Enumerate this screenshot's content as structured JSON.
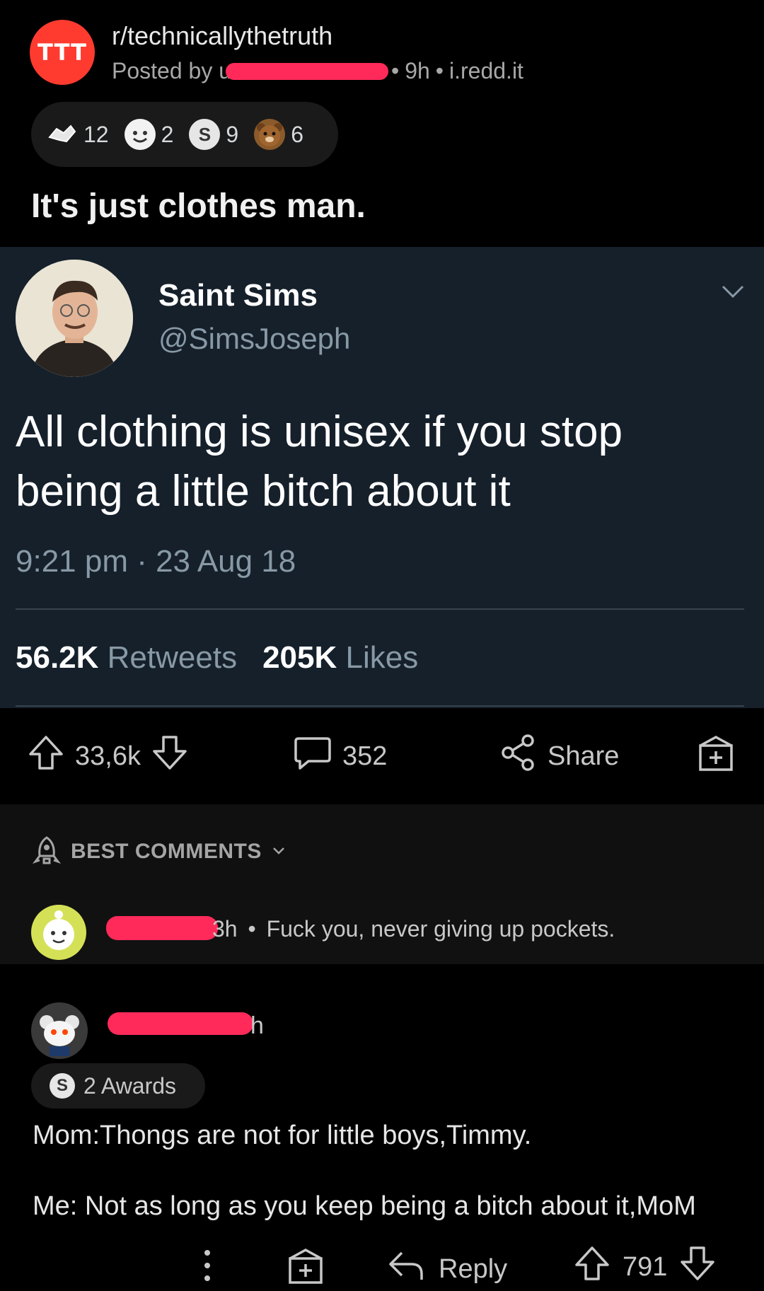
{
  "header": {
    "subreddit_icon_text": "TTT",
    "subreddit": "r/technicallythetruth",
    "posted_by_prefix": "Posted by u",
    "time": "9h",
    "domain": "i.redd.it",
    "separator": "•"
  },
  "awards": [
    {
      "icon": "handshake-award-icon",
      "count": "12"
    },
    {
      "icon": "wholesome-award-icon",
      "count": "2"
    },
    {
      "icon": "silver-coin-award-icon",
      "count": "9"
    },
    {
      "icon": "bear-award-icon",
      "count": "6"
    }
  ],
  "post": {
    "title": "It's just clothes man."
  },
  "tweet": {
    "name": "Saint Sims",
    "handle": "@SimsJoseph",
    "text": "All clothing is unisex if you stop being a little bitch about it",
    "timestamp": "9:21 pm · 23 Aug 18",
    "retweets_count": "56.2K",
    "retweets_label": "Retweets",
    "likes_count": "205K",
    "likes_label": "Likes"
  },
  "actions": {
    "votes": "33,6k",
    "comments": "352",
    "share_label": "Share"
  },
  "sort": {
    "label": "BEST COMMENTS"
  },
  "comments": [
    {
      "time_fragment": "3h",
      "separator": "•",
      "text": "Fuck you, never giving up pockets."
    },
    {
      "time_fragment": "h",
      "awards_label": "2 Awards",
      "line1": "Mom:Thongs are not for little boys,Timmy.",
      "line2": "Me: Not as long as you keep being a bitch about it,MoM",
      "reply_label": "Reply",
      "votes": "791"
    }
  ],
  "colors": {
    "background": "#000000",
    "tweet_bg": "#15202b",
    "redaction": "#ff2a5a",
    "subreddit_icon": "#ff3b30"
  }
}
